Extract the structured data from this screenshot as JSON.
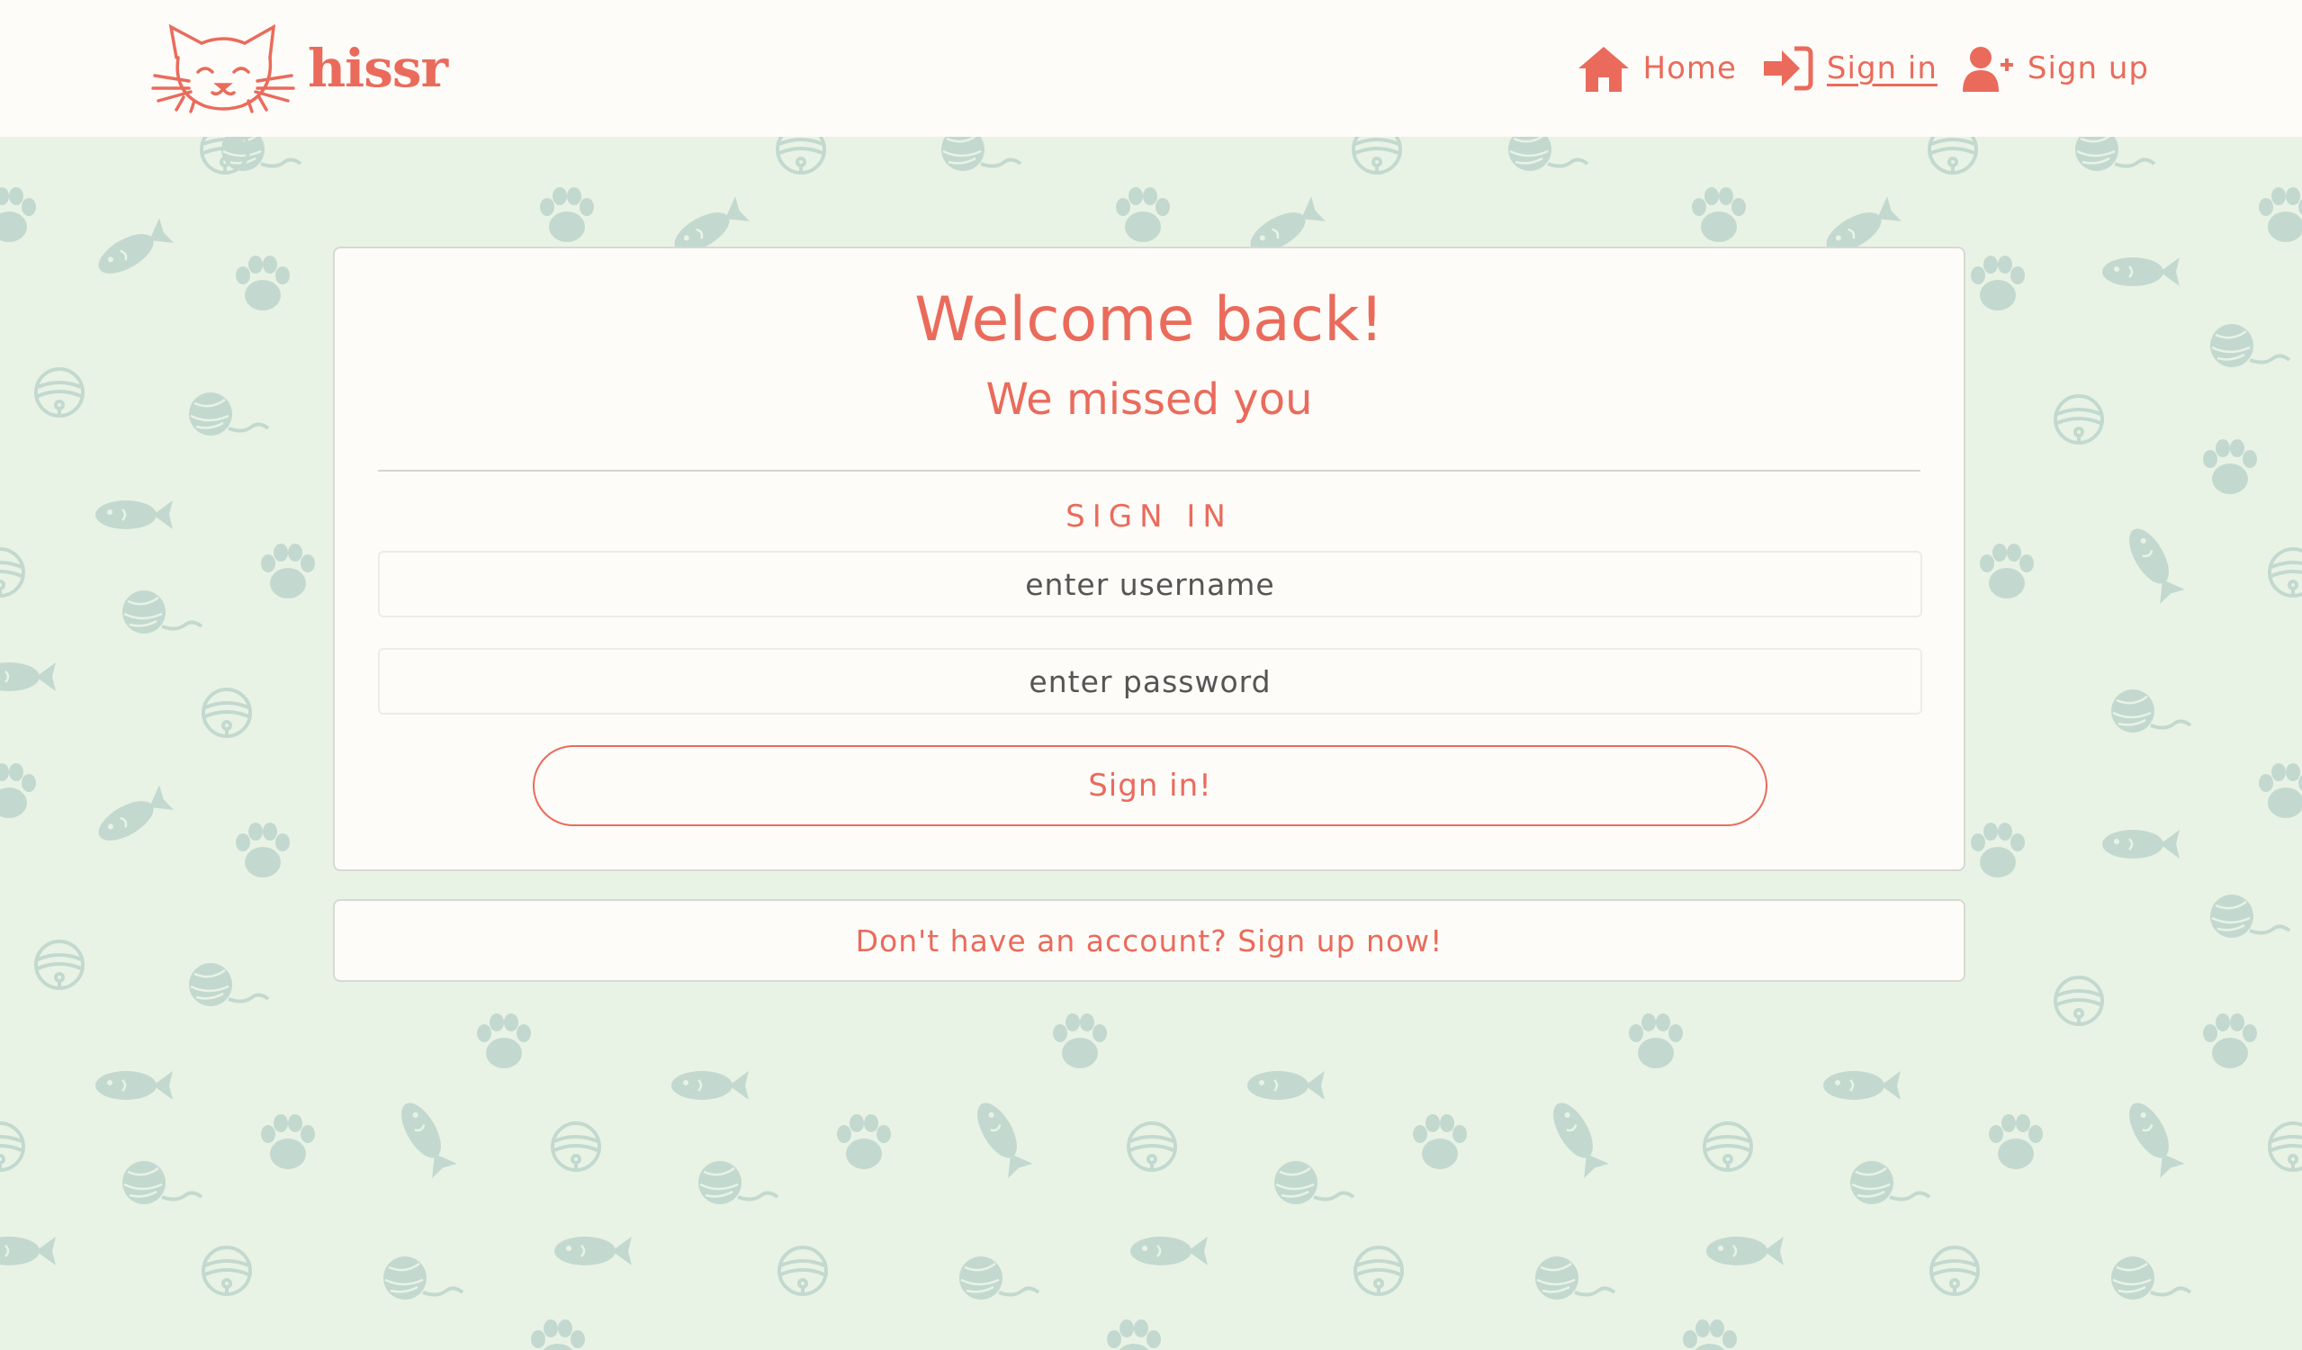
{
  "brand": {
    "name": "hissr",
    "logo_icon": "cat-face-icon"
  },
  "nav": {
    "items": [
      {
        "label": "Home",
        "icon": "home-icon",
        "active": false
      },
      {
        "label": "Sign in",
        "icon": "sign-in-icon",
        "active": true
      },
      {
        "label": "Sign up",
        "icon": "user-plus-icon",
        "active": false
      }
    ]
  },
  "signin": {
    "title": "Welcome back!",
    "subtitle": "We missed you",
    "section_label": "SIGN IN",
    "username_placeholder": "enter username",
    "password_placeholder": "enter password",
    "submit_label": "Sign in!"
  },
  "footer_card": {
    "signup_link": "Don't have an account? Sign up now!"
  },
  "colors": {
    "accent": "#ea6b5b",
    "background": "#e8f3e5",
    "pattern": "#c3d9d0",
    "card": "#fdfcf9"
  },
  "background_pattern_icons": [
    "paw-icon",
    "fish-icon",
    "yarn-ball-icon",
    "bell-icon"
  ]
}
